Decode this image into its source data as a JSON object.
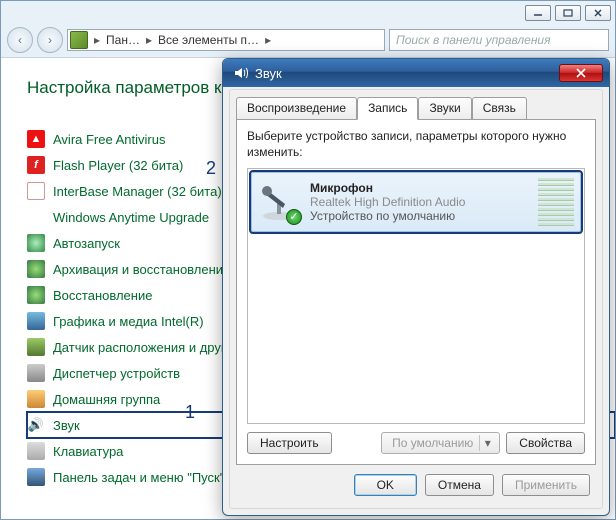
{
  "explorer": {
    "nav": {
      "back": "‹",
      "fwd": "›"
    },
    "breadcrumb": {
      "seg1": "Пан…",
      "seg2": "Все элементы п…"
    },
    "search_placeholder": "Поиск в панели управления"
  },
  "cp": {
    "title": "Настройка параметров ко",
    "items": [
      {
        "label": "Avira Free Antivirus",
        "icon": "ico-avira",
        "glyph": "▲"
      },
      {
        "label": "Flash Player (32 бита)",
        "icon": "ico-flash",
        "glyph": "f"
      },
      {
        "label": "InterBase Manager (32 бита)",
        "icon": "ico-ib",
        "glyph": ""
      },
      {
        "label": "Windows Anytime Upgrade",
        "icon": "ico-win",
        "glyph": ""
      },
      {
        "label": "Автозапуск",
        "icon": "ico-gear",
        "glyph": ""
      },
      {
        "label": "Архивация и восстановление",
        "icon": "ico-refresh",
        "glyph": ""
      },
      {
        "label": "Восстановление",
        "icon": "ico-refresh",
        "glyph": ""
      },
      {
        "label": "Графика и медиа Intel(R)",
        "icon": "ico-display",
        "glyph": ""
      },
      {
        "label": "Датчик расположения и други",
        "icon": "ico-sensor",
        "glyph": ""
      },
      {
        "label": "Диспетчер устройств",
        "icon": "ico-device",
        "glyph": ""
      },
      {
        "label": "Домашняя группа",
        "icon": "ico-home",
        "glyph": ""
      },
      {
        "label": "Звук",
        "icon": "ico-sound",
        "glyph": "🔊",
        "selected": true
      },
      {
        "label": "Клавиатура",
        "icon": "ico-kbd",
        "glyph": ""
      },
      {
        "label": "Панель задач и меню \"Пуск\"",
        "icon": "ico-taskbar",
        "glyph": ""
      }
    ],
    "markers": {
      "one": "1",
      "two": "2"
    }
  },
  "dlg": {
    "title": "Звук",
    "tabs": {
      "playback": "Воспроизведение",
      "recording": "Запись",
      "sounds": "Звуки",
      "comm": "Связь"
    },
    "instruction": "Выберите устройство записи, параметры которого нужно изменить:",
    "device": {
      "name": "Микрофон",
      "driver": "Realtek High Definition Audio",
      "status": "Устройство по умолчанию"
    },
    "buttons": {
      "configure": "Настроить",
      "default": "По умолчанию",
      "properties": "Свойства",
      "ok": "OK",
      "cancel": "Отмена",
      "apply": "Применить"
    }
  }
}
